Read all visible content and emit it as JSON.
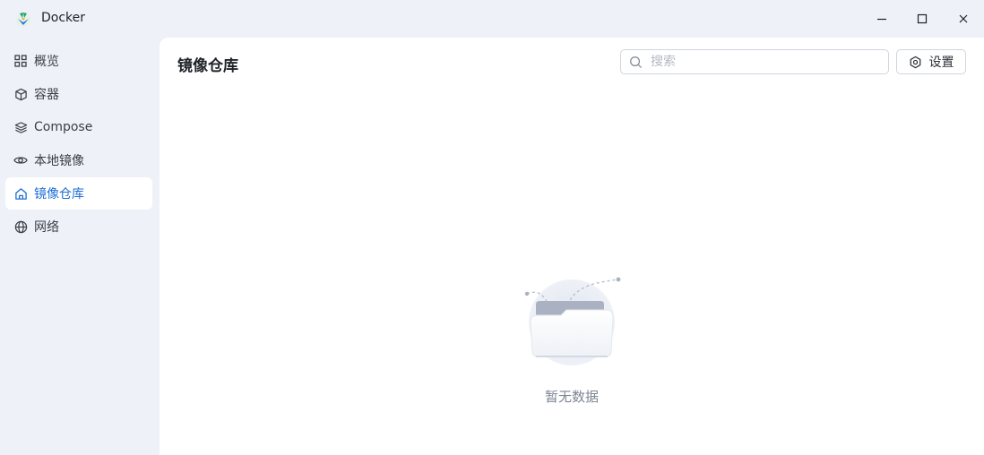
{
  "app": {
    "title": "Docker",
    "brand_colors": [
      "#22a06b",
      "#2f6fde",
      "#f0b429"
    ]
  },
  "window_controls": {
    "minimize_icon": "minimize-icon",
    "maximize_icon": "maximize-icon",
    "close_icon": "close-icon"
  },
  "sidebar": {
    "items": [
      {
        "label": "概览",
        "icon": "grid-icon",
        "active": false
      },
      {
        "label": "容器",
        "icon": "cube-icon",
        "active": false
      },
      {
        "label": "Compose",
        "icon": "layers-icon",
        "active": false
      },
      {
        "label": "本地镜像",
        "icon": "eye-icon",
        "active": false
      },
      {
        "label": "镜像仓库",
        "icon": "home-icon",
        "active": true
      },
      {
        "label": "网络",
        "icon": "globe-icon",
        "active": false
      }
    ],
    "active_color": "#1f6fd4"
  },
  "main": {
    "title": "镜像仓库",
    "search": {
      "placeholder": "搜索",
      "value": ""
    },
    "settings_label": "设置",
    "empty_text": "暂无数据"
  }
}
